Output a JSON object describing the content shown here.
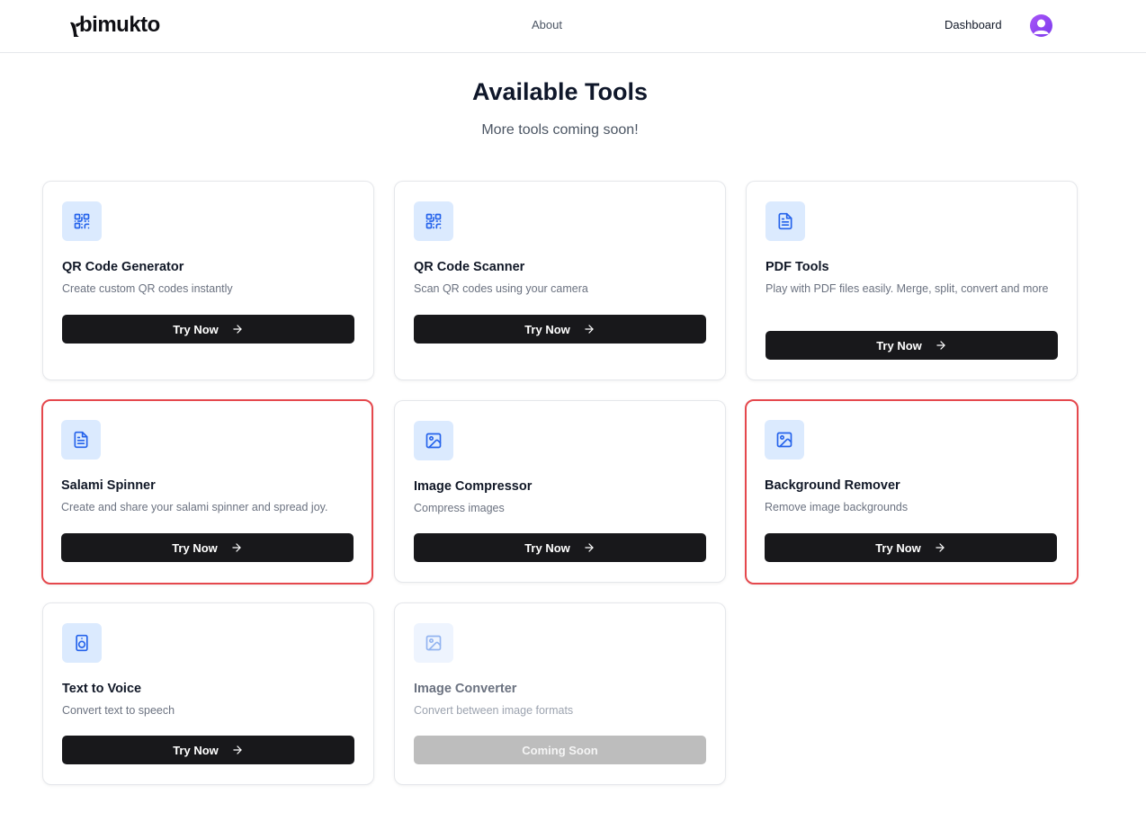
{
  "brand": {
    "name": "bimukto"
  },
  "nav": {
    "about": "About",
    "dashboard": "Dashboard"
  },
  "page": {
    "title": "Available Tools",
    "subtitle": "More tools coming soon!"
  },
  "tools": [
    {
      "title": "QR Code Generator",
      "desc": "Create custom QR codes instantly",
      "button": "Try Now",
      "icon": "qr-code-icon"
    },
    {
      "title": "QR Code Scanner",
      "desc": "Scan QR codes using your camera",
      "button": "Try Now",
      "icon": "qr-code-icon"
    },
    {
      "title": "PDF Tools",
      "desc": "Play with PDF files easily. Merge, split, convert and more",
      "button": "Try Now",
      "icon": "file-text-icon"
    },
    {
      "title": "Salami Spinner",
      "desc": "Create and share your salami spinner and spread joy.",
      "button": "Try Now",
      "icon": "file-text-icon"
    },
    {
      "title": "Image Compressor",
      "desc": "Compress images",
      "button": "Try Now",
      "icon": "image-icon"
    },
    {
      "title": "Background Remover",
      "desc": "Remove image backgrounds",
      "button": "Try Now",
      "icon": "image-icon"
    },
    {
      "title": "Text to Voice",
      "desc": "Convert text to speech",
      "button": "Try Now",
      "icon": "speaker-icon"
    },
    {
      "title": "Image Converter",
      "desc": "Convert between image formats",
      "button": "Coming Soon",
      "icon": "image-icon"
    }
  ],
  "colors": {
    "primary_button": "#18181b",
    "icon_bg": "#dbeafe",
    "icon_fg": "#2563eb",
    "highlight_border": "#e5484d",
    "disabled_button": "#bdbdbd"
  }
}
